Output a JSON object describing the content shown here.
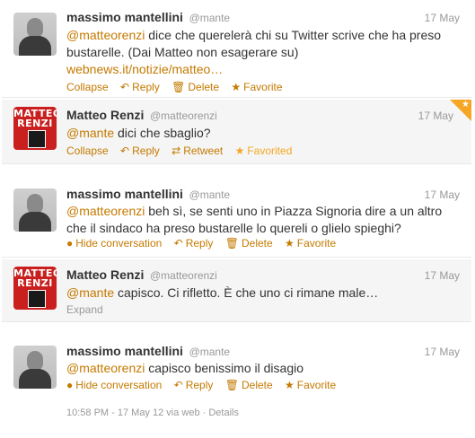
{
  "tweets": [
    {
      "name": "massimo mantellini",
      "handle": "@mante",
      "date": "17 May",
      "mention": "@matteorenzi",
      "text": " dice che querelerà chi su Twitter scrive che ha preso bustarelle. (Dai Matteo non esagerare su)",
      "link": "webnews.it/notizie/matteo…",
      "actions": [
        {
          "icon": "collapse",
          "label": "Collapse"
        },
        {
          "icon": "reply-arrow-icon",
          "label": "Reply"
        },
        {
          "icon": "trash-icon",
          "label": "Delete"
        },
        {
          "icon": "star-icon",
          "label": "Favorite"
        }
      ]
    },
    {
      "name": "Matteo Renzi",
      "handle": "@matteorenzi",
      "date": "17 May",
      "mention": "@mante",
      "text": " dici che sbaglio?",
      "avatar_lines": [
        "MATTEO",
        "RENZI"
      ],
      "actions": [
        {
          "icon": "collapse",
          "label": "Collapse"
        },
        {
          "icon": "reply-arrow-icon",
          "label": "Reply"
        },
        {
          "icon": "retweet-icon",
          "label": "Retweet"
        },
        {
          "icon": "star-icon",
          "label": "Favorited"
        }
      ]
    },
    {
      "name": "massimo mantellini",
      "handle": "@mante",
      "date": "17 May",
      "mention": "@matteorenzi",
      "text": " beh sì, se senti uno in Piazza Signoria dire a un altro che il sindaco ha preso bustarelle lo quereli o glielo spieghi?",
      "actions": [
        {
          "icon": "conversation-bubble-icon",
          "label": "Hide conversation"
        },
        {
          "icon": "reply-arrow-icon",
          "label": "Reply"
        },
        {
          "icon": "trash-icon",
          "label": "Delete"
        },
        {
          "icon": "star-icon",
          "label": "Favorite"
        }
      ]
    },
    {
      "name": "Matteo Renzi",
      "handle": "@matteorenzi",
      "date": "17 May",
      "mention": "@mante",
      "text": " capisco. Ci rifletto. È che uno ci rimane male…",
      "avatar_lines": [
        "MATTEO",
        "RENZI"
      ],
      "expand": "Expand"
    },
    {
      "name": "massimo mantellini",
      "handle": "@mante",
      "date": "17 May",
      "mention": "@matteorenzi",
      "text": " capisco benissimo il disagio",
      "actions": [
        {
          "icon": "conversation-bubble-icon",
          "label": "Hide conversation"
        },
        {
          "icon": "reply-arrow-icon",
          "label": "Reply"
        },
        {
          "icon": "trash-icon",
          "label": "Delete"
        },
        {
          "icon": "star-icon",
          "label": "Favorite"
        }
      ],
      "timestamp": "10:58 PM - 17 May 12 via web · Details"
    }
  ],
  "colors": {
    "accent": "#c47a00",
    "favorited": "#f5a623",
    "muted": "#999999"
  }
}
